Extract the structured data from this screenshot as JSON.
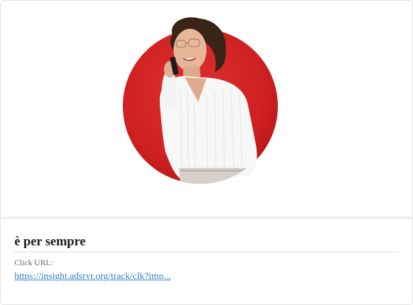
{
  "ad": {
    "image": {
      "description_icon": "woman-on-phone-photo",
      "circle_color": "#d42424",
      "sweater_color": "#f7f7f7"
    },
    "headline": "è per sempre",
    "click_label": "Click URL:",
    "click_url": "https://insight.adsrvr.org/track/clk?imp..."
  },
  "colors": {
    "link": "#2f7fc4",
    "headline": "#1b1b1b",
    "muted": "#666666",
    "border": "#e2e2e2"
  }
}
